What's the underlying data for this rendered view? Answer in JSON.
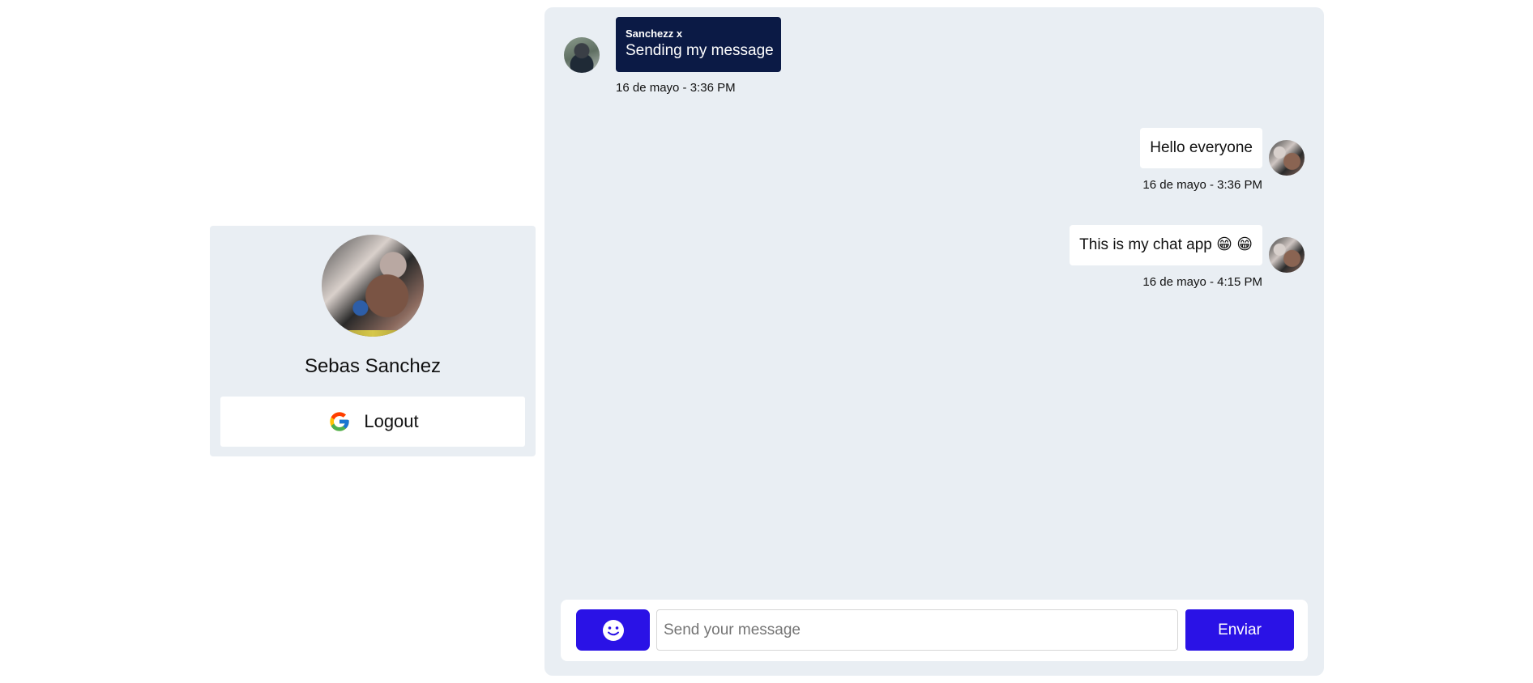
{
  "profile": {
    "name": "Sebas Sanchez",
    "logout_label": "Logout",
    "avatar_icon": "user-photo"
  },
  "messages": [
    {
      "direction": "incoming",
      "sender": "Sanchezz x",
      "text": "Sending my message",
      "timestamp": "16 de mayo - 3:36 PM"
    },
    {
      "direction": "outgoing",
      "text": "Hello everyone",
      "timestamp": "16 de mayo - 3:36 PM"
    },
    {
      "direction": "outgoing",
      "text": "This is my chat app 😁 😁",
      "timestamp": "16 de mayo - 4:15 PM"
    }
  ],
  "composer": {
    "placeholder": "Send your message",
    "value": "",
    "send_label": "Enviar",
    "emoji_icon": "smiley-icon"
  },
  "colors": {
    "accent": "#2a12e6",
    "incoming_bubble": "#0b1a45",
    "panel_bg": "#e9eef3",
    "outgoing_bubble": "#ffffff"
  }
}
